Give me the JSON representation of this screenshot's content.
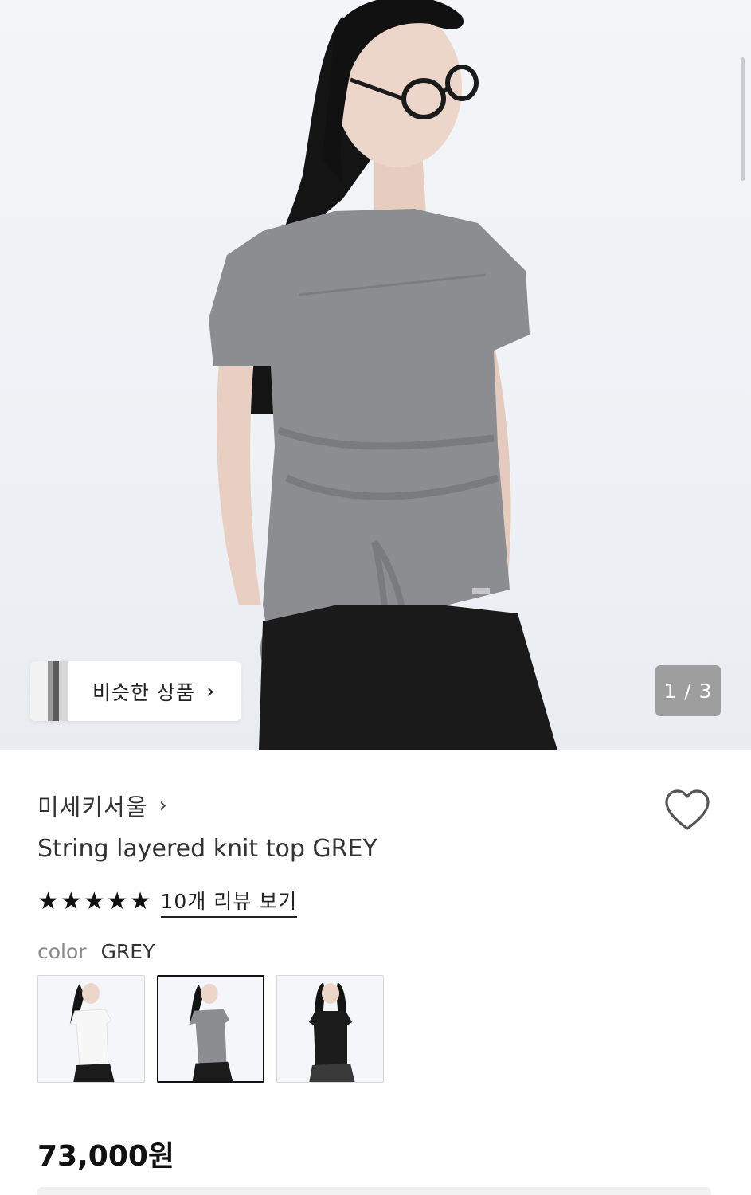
{
  "gallery": {
    "similar_label": "비슷한 상품",
    "similar_chevron": "›",
    "page_indicator": "1 / 3"
  },
  "product": {
    "brand": "미세키서울",
    "brand_chevron": "›",
    "title": "String layered knit top GREY",
    "rating_stars": 5,
    "review_link": "10개 리뷰 보기",
    "color_label": "color",
    "color_value": "GREY",
    "swatches": [
      {
        "name": "white",
        "color": "#f4f4f4"
      },
      {
        "name": "grey",
        "color": "#8a8a8a",
        "selected": true
      },
      {
        "name": "black",
        "color": "#1c1c1c"
      }
    ],
    "price": "73,000원"
  },
  "colors": {
    "top_grey": "#8c8d90",
    "skirt_black": "#1a1a1a",
    "hair": "#141414",
    "skin": "#e9d2c6",
    "background": "#f1f4f7",
    "indicator_bg": "#9e9e9e"
  },
  "icons": {
    "wishlist": "heart-outline-icon",
    "star": "star-filled-icon",
    "chevron": "chevron-right-icon"
  }
}
